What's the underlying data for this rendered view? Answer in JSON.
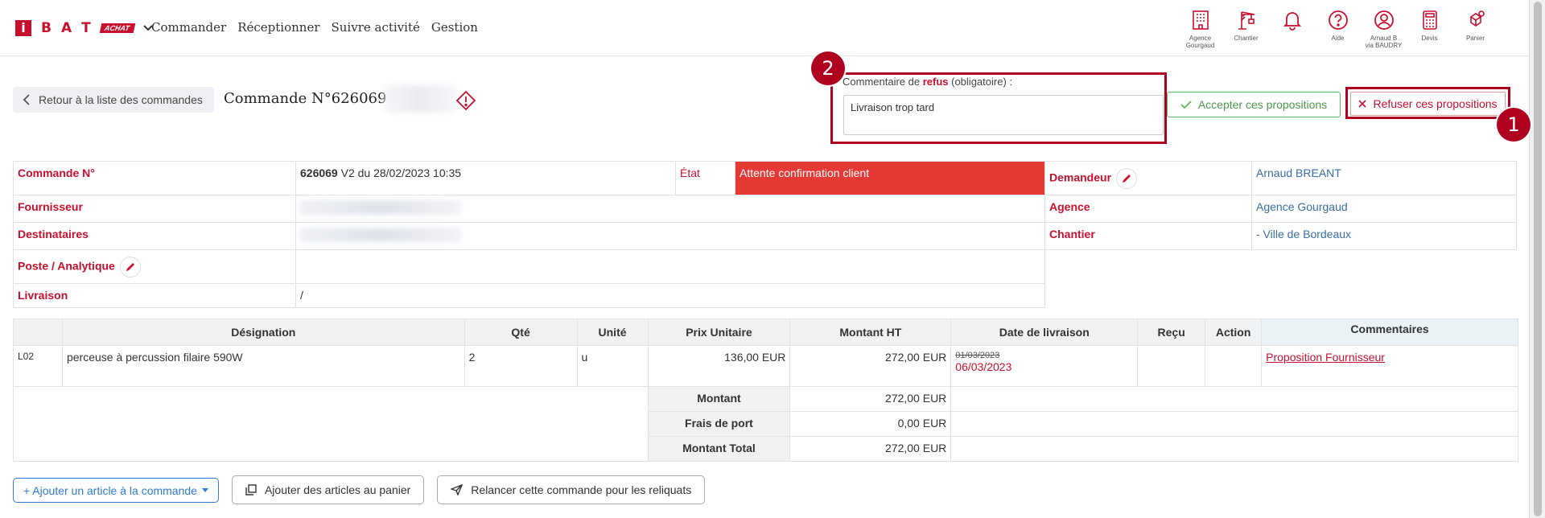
{
  "header": {
    "logo_letter": "i",
    "logo_letters": [
      "B",
      "A",
      "T"
    ],
    "logo_badge": "ACHAT",
    "nav": [
      "Commander",
      "Réceptionner",
      "Suivre activité",
      "Gestion"
    ],
    "icons": [
      {
        "name": "building-icon",
        "label": "Agence\nGourgaud"
      },
      {
        "name": "crane-icon",
        "label": "Chantier"
      },
      {
        "name": "bell-icon",
        "label": ""
      },
      {
        "name": "help-icon",
        "label": "Aide"
      },
      {
        "name": "user-icon",
        "label": "Arnaud B\nvia BAUDRY"
      },
      {
        "name": "calculator-icon",
        "label": "Devis"
      },
      {
        "name": "cart-icon",
        "label": "Panier"
      }
    ]
  },
  "title_row": {
    "back_label": "Retour à la liste des commandes",
    "order_title": "Commande N°626069 -",
    "comment_label_prefix": "Commentaire de ",
    "comment_label_strong": "refus",
    "comment_label_suffix": " (obligatoire) :",
    "comment_value": "Livraison trop tard",
    "accept_label": "Accepter ces propositions",
    "refuse_label": "Refuser ces propositions",
    "badge_1": "1",
    "badge_2": "2"
  },
  "info": {
    "order_label": "Commande N°",
    "order_number": "626069",
    "order_version": " V2 du 28/02/2023 10:35",
    "state_label": "État",
    "state_value": "Attente confirmation client",
    "requester_label": "Demandeur",
    "requester_value": "Arnaud BREANT",
    "supplier_label": "Fournisseur",
    "agency_label": "Agence",
    "agency_value": "Agence Gourgaud",
    "recipients_label": "Destinataires",
    "site_label": "Chantier",
    "site_value": "- Ville de Bordeaux",
    "post_label": "Poste / Analytique",
    "delivery_label": "Livraison",
    "delivery_value": "/"
  },
  "lines": {
    "headers": [
      "",
      "Désignation",
      "Qté",
      "Unité",
      "Prix Unitaire",
      "Montant HT",
      "Date de livraison",
      "Reçu",
      "Action",
      "Commentaires"
    ],
    "rows": [
      {
        "ref": "L02",
        "designation": "perceuse à percussion filaire 590W",
        "qty": "2",
        "unit": "u",
        "unit_price": "136,00 EUR",
        "amount": "272,00 EUR",
        "old_date": "01/03/2023",
        "new_date": "06/03/2023",
        "received": "",
        "action": "",
        "comment_link": "Proposition Fournisseur"
      }
    ],
    "totals": [
      {
        "label": "Montant",
        "value": "272,00 EUR"
      },
      {
        "label": "Frais de port",
        "value": "0,00 EUR"
      },
      {
        "label": "Montant Total",
        "value": "272,00 EUR"
      }
    ]
  },
  "bottom": {
    "add_article": "+ Ajouter un article à la commande",
    "add_to_cart": "Ajouter des articles au panier",
    "relaunch": "Relancer cette commande pour les reliquats"
  },
  "colors": {
    "brand_red": "#c8102e",
    "annotation_red": "#b00020",
    "state_red": "#e53935",
    "accept_green": "#5cb85c",
    "link_blue": "#3a6ea5",
    "button_blue": "#2f7bd6"
  }
}
